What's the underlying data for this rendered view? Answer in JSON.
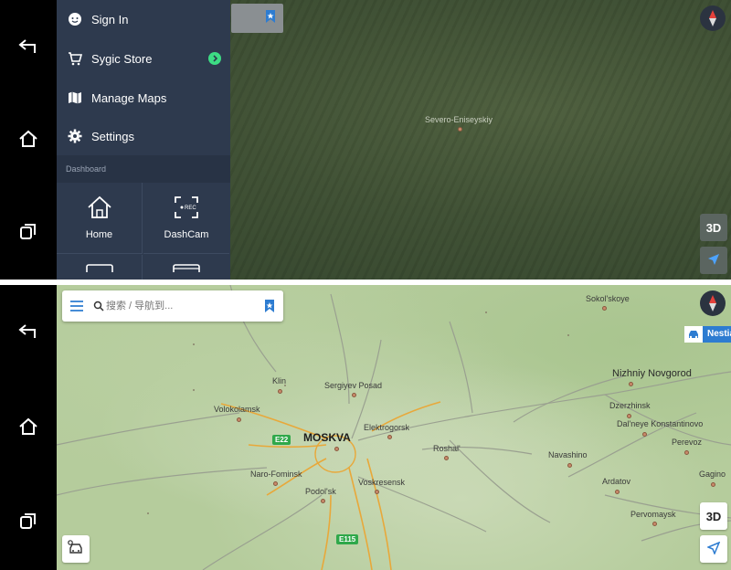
{
  "top_screen": {
    "menu": {
      "items": [
        {
          "label": "Sign In",
          "icon": "face-icon"
        },
        {
          "label": "Sygic Store",
          "icon": "cart-icon"
        },
        {
          "label": "Manage Maps",
          "icon": "map-icon"
        },
        {
          "label": "Settings",
          "icon": "gear-icon"
        }
      ],
      "section_title": "Dashboard",
      "tiles": [
        {
          "label": "Home",
          "icon": "home-icon"
        },
        {
          "label": "DashCam",
          "icon": "dashcam-icon"
        }
      ]
    },
    "map": {
      "place": "Severo-Eniseyskiy",
      "button_3d": "3D"
    }
  },
  "bottom_screen": {
    "search": {
      "placeholder": "搜索 / 导航到..."
    },
    "map": {
      "cities": [
        {
          "name": "Sokol'skoye"
        },
        {
          "name": "Nizhniy Novgorod"
        },
        {
          "name": "Klin"
        },
        {
          "name": "Sergiyev Posad"
        },
        {
          "name": "Volokolamsk"
        },
        {
          "name": "Dzerzhinsk"
        },
        {
          "name": "Elektrogorsk"
        },
        {
          "name": "Dal'neye Konstantinovo"
        },
        {
          "name": "MOSKVA"
        },
        {
          "name": "Roshal'"
        },
        {
          "name": "Perevoz"
        },
        {
          "name": "Navashino"
        },
        {
          "name": "Naro-Fominsk"
        },
        {
          "name": "Gagino"
        },
        {
          "name": "Voskresensk"
        },
        {
          "name": "Ardatov"
        },
        {
          "name": "Podol'sk"
        },
        {
          "name": "Pervomaysk"
        }
      ],
      "road_badges": [
        "E22",
        "E115"
      ],
      "nest_label": "Nestia",
      "button_3d": "3D"
    }
  },
  "colors": {
    "menu_bg": "#2e3a4e",
    "accent_blue": "#2d7cd1",
    "store_badge": "#3ddc84"
  }
}
